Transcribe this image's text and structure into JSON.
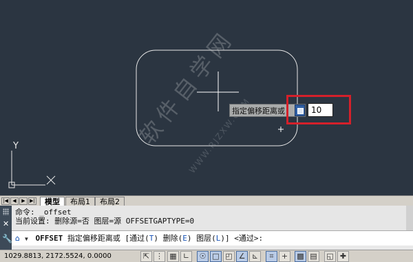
{
  "tooltip": {
    "prompt_label": "指定偏移距离或",
    "input_value": "10"
  },
  "ucs": {
    "y_label": "Y",
    "x_label": "X"
  },
  "watermark": {
    "main": "软件自学网",
    "sub": "WWW.RJZXW.COM"
  },
  "tabs": {
    "items": [
      {
        "label": "模型",
        "active": true
      },
      {
        "label": "布局1",
        "active": false
      },
      {
        "label": "布局2",
        "active": false
      }
    ]
  },
  "command": {
    "history_line1": "命令: _offset",
    "history_line2": "当前设置: 删除源=否  图层=源  OFFSETGAPTYPE=0",
    "cmd_name": "OFFSET",
    "prompt_text": "指定偏移距离或",
    "opt_open": "[",
    "opt1_label": "通过",
    "opt1_key": "T",
    "opt2_label": "删除",
    "opt2_key": "E",
    "opt3_label": "图层",
    "opt3_key": "L",
    "opt_close": "]",
    "default_text": "<通过>:"
  },
  "status": {
    "coords": "1029.8813, 2172.5524, 0.0000"
  },
  "colors": {
    "canvas": "#2b3541",
    "highlight": "#d5202a",
    "drawing": "#e8e8e8"
  }
}
